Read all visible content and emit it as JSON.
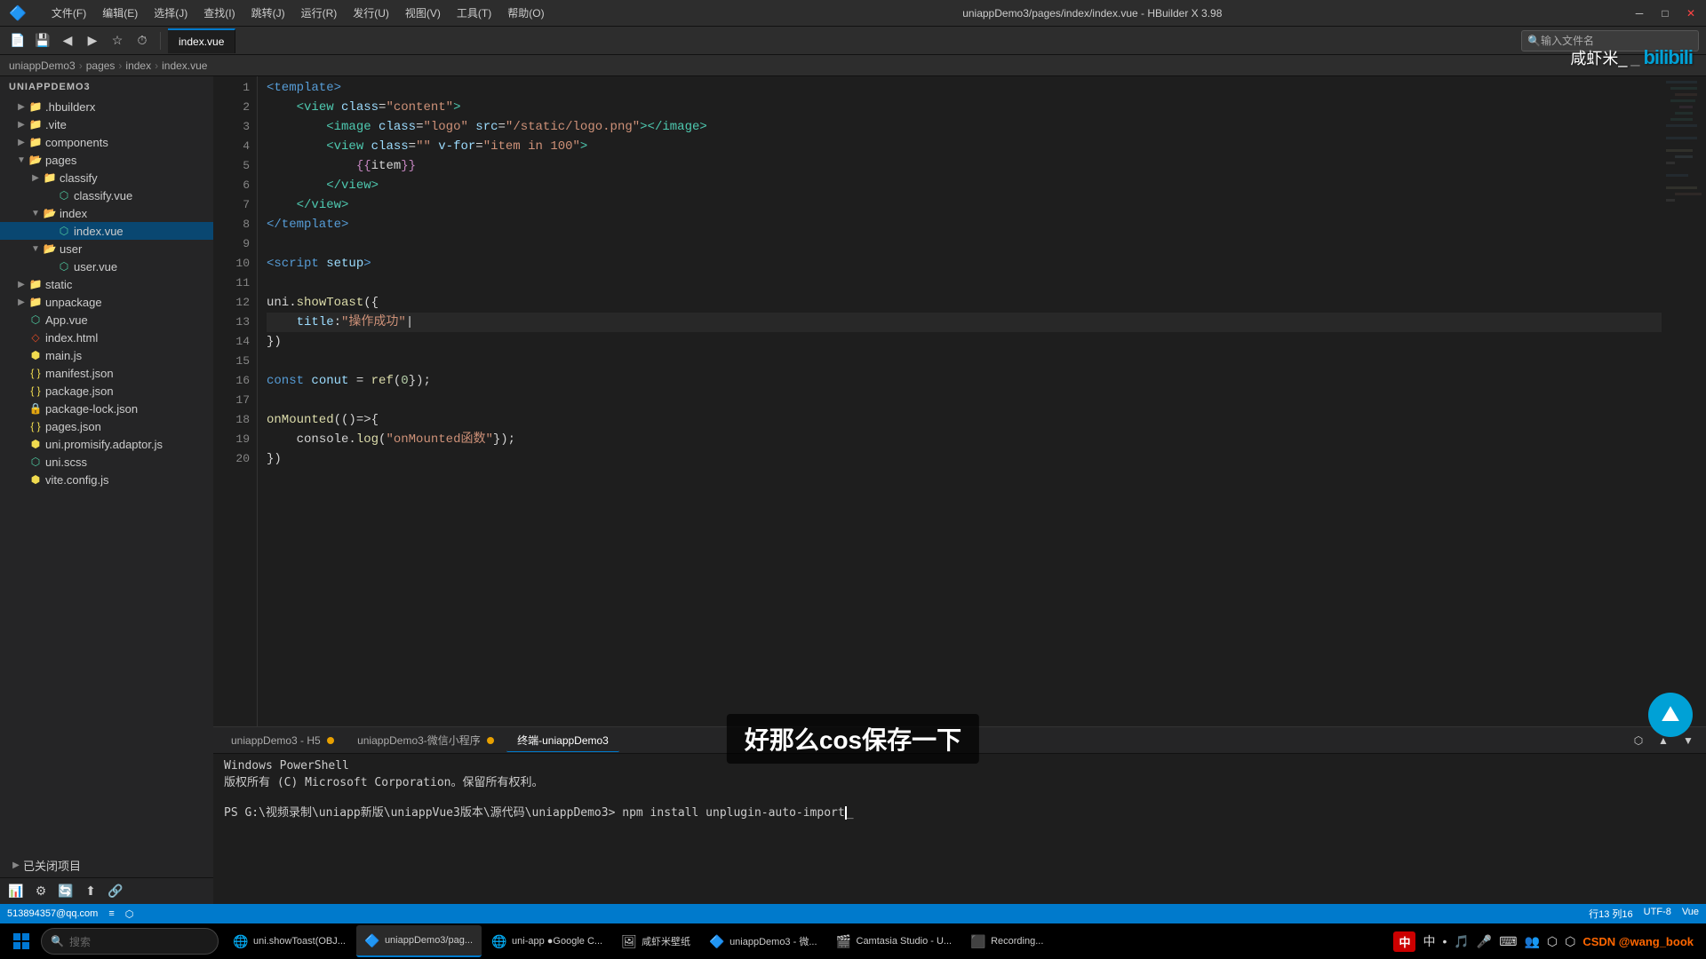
{
  "window": {
    "title": "uniappDemo3/pages/index/index.vue - HBuilder X 3.98",
    "min_btn": "─",
    "max_btn": "□",
    "close_btn": "✕"
  },
  "menu": {
    "items": [
      "文件(F)",
      "编辑(E)",
      "选择(J)",
      "查找(I)",
      "跳转(J)",
      "运行(R)",
      "发行(U)",
      "视图(V)",
      "工具(T)",
      "帮助(O)"
    ]
  },
  "breadcrumb": {
    "items": [
      "uniappDemo3",
      "pages",
      "index",
      "index.vue"
    ]
  },
  "tabs": [
    {
      "label": "index.vue",
      "active": true,
      "dot": false
    },
    {
      "label": "uniappDemo3-微信小程序",
      "active": false,
      "dot": true,
      "dot_color": "orange"
    },
    {
      "label": "终端-uniappDemo3",
      "active": false,
      "dot": false
    }
  ],
  "file_tab": {
    "label": "index.vue"
  },
  "input_filename": {
    "placeholder": "输入文件名"
  },
  "sidebar": {
    "project": "uniappDemo3",
    "items": [
      {
        "id": "hbuilderx",
        "label": ".hbuilderx",
        "type": "folder",
        "depth": 1,
        "collapsed": true
      },
      {
        "id": "vite",
        "label": ".vite",
        "type": "folder",
        "depth": 1,
        "collapsed": true
      },
      {
        "id": "components",
        "label": "components",
        "type": "folder",
        "depth": 1,
        "collapsed": true
      },
      {
        "id": "pages",
        "label": "pages",
        "type": "folder",
        "depth": 1,
        "collapsed": false
      },
      {
        "id": "classify",
        "label": "classify",
        "type": "folder",
        "depth": 2,
        "collapsed": true
      },
      {
        "id": "classify_vue",
        "label": "classify.vue",
        "type": "vue",
        "depth": 3
      },
      {
        "id": "index_folder",
        "label": "index",
        "type": "folder",
        "depth": 2,
        "collapsed": false
      },
      {
        "id": "index_vue",
        "label": "index.vue",
        "type": "vue",
        "depth": 3,
        "selected": true
      },
      {
        "id": "user_folder",
        "label": "user",
        "type": "folder",
        "depth": 2,
        "collapsed": false
      },
      {
        "id": "user_vue",
        "label": "user.vue",
        "type": "vue",
        "depth": 3
      },
      {
        "id": "static",
        "label": "static",
        "type": "folder",
        "depth": 1,
        "collapsed": true
      },
      {
        "id": "unpackage",
        "label": "unpackage",
        "type": "folder",
        "depth": 1,
        "collapsed": true
      },
      {
        "id": "app_vue",
        "label": "App.vue",
        "type": "vue",
        "depth": 1
      },
      {
        "id": "index_html",
        "label": "index.html",
        "type": "html",
        "depth": 1
      },
      {
        "id": "main_js",
        "label": "main.js",
        "type": "js",
        "depth": 1
      },
      {
        "id": "manifest_json",
        "label": "manifest.json",
        "type": "json",
        "depth": 1
      },
      {
        "id": "package_json",
        "label": "package.json",
        "type": "json",
        "depth": 1
      },
      {
        "id": "package_lock",
        "label": "package-lock.json",
        "type": "lock",
        "depth": 1
      },
      {
        "id": "pages_json",
        "label": "pages.json",
        "type": "json",
        "depth": 1
      },
      {
        "id": "uni_promisify",
        "label": "uni.promisify.adaptor.js",
        "type": "js",
        "depth": 1
      },
      {
        "id": "uni_scss",
        "label": "uni.scss",
        "type": "css",
        "depth": 1
      },
      {
        "id": "vite_config",
        "label": "vite.config.js",
        "type": "js",
        "depth": 1
      }
    ],
    "closed_projects": "已关闭项目"
  },
  "code_lines": [
    {
      "num": 1,
      "content": "<template>",
      "tokens": [
        {
          "t": "tmpl",
          "v": "<template>"
        }
      ]
    },
    {
      "num": 2,
      "content": "    <view class=\"content\">",
      "tokens": [
        {
          "t": "plain",
          "v": "    "
        },
        {
          "t": "tag",
          "v": "<view"
        },
        {
          "t": "plain",
          "v": " "
        },
        {
          "t": "attr",
          "v": "class"
        },
        {
          "t": "plain",
          "v": "="
        },
        {
          "t": "str",
          "v": "\"content\""
        },
        {
          "t": "tag",
          "v": ">"
        }
      ]
    },
    {
      "num": 3,
      "content": "        <image class=\"logo\" src=\"/static/logo.png\"></image>",
      "tokens": [
        {
          "t": "plain",
          "v": "        "
        },
        {
          "t": "tag",
          "v": "<image"
        },
        {
          "t": "plain",
          "v": " "
        },
        {
          "t": "attr",
          "v": "class"
        },
        {
          "t": "plain",
          "v": "="
        },
        {
          "t": "str",
          "v": "\"logo\""
        },
        {
          "t": "plain",
          "v": " "
        },
        {
          "t": "attr",
          "v": "src"
        },
        {
          "t": "plain",
          "v": "="
        },
        {
          "t": "str",
          "v": "\"/static/logo.png\""
        },
        {
          "t": "tag",
          "v": "></image>"
        }
      ]
    },
    {
      "num": 4,
      "content": "        <view class=\"\" v-for=\"item in 100\">",
      "tokens": [
        {
          "t": "plain",
          "v": "        "
        },
        {
          "t": "tag",
          "v": "<view"
        },
        {
          "t": "plain",
          "v": " "
        },
        {
          "t": "attr",
          "v": "class"
        },
        {
          "t": "plain",
          "v": "="
        },
        {
          "t": "str",
          "v": "\"\""
        },
        {
          "t": "plain",
          "v": " "
        },
        {
          "t": "attr",
          "v": "v-for"
        },
        {
          "t": "plain",
          "v": "="
        },
        {
          "t": "str",
          "v": "\"item in 100\""
        },
        {
          "t": "tag",
          "v": ">"
        }
      ]
    },
    {
      "num": 5,
      "content": "            {{item}}",
      "tokens": [
        {
          "t": "plain",
          "v": "            "
        },
        {
          "t": "kw2",
          "v": "{{"
        },
        {
          "t": "plain",
          "v": "item"
        },
        {
          "t": "kw2",
          "v": "}}"
        }
      ]
    },
    {
      "num": 6,
      "content": "        </view>",
      "tokens": [
        {
          "t": "plain",
          "v": "        "
        },
        {
          "t": "tag",
          "v": "</view>"
        }
      ]
    },
    {
      "num": 7,
      "content": "    </view>",
      "tokens": [
        {
          "t": "plain",
          "v": "    "
        },
        {
          "t": "tag",
          "v": "</view>"
        }
      ]
    },
    {
      "num": 8,
      "content": "</template>",
      "tokens": [
        {
          "t": "tmpl",
          "v": "</template>"
        }
      ]
    },
    {
      "num": 9,
      "content": "",
      "tokens": []
    },
    {
      "num": 10,
      "content": "<script setup>",
      "tokens": [
        {
          "t": "tmpl",
          "v": "<script"
        },
        {
          "t": "plain",
          "v": " "
        },
        {
          "t": "attr",
          "v": "setup"
        },
        {
          "t": "tmpl",
          "v": ">"
        }
      ]
    },
    {
      "num": 11,
      "content": "",
      "tokens": []
    },
    {
      "num": 12,
      "content": "uni.showToast({",
      "tokens": [
        {
          "t": "plain",
          "v": "uni"
        },
        {
          "t": "punct",
          "v": "."
        },
        {
          "t": "func",
          "v": "showToast"
        },
        {
          "t": "punct",
          "v": "({"
        }
      ]
    },
    {
      "num": 13,
      "content": "    title:\"操作成功\"|",
      "tokens": [
        {
          "t": "plain",
          "v": "    "
        },
        {
          "t": "lightblue",
          "v": "title"
        },
        {
          "t": "punct",
          "v": ":"
        },
        {
          "t": "str",
          "v": "\"操作成功\""
        },
        {
          "t": "plain",
          "v": "|"
        }
      ]
    },
    {
      "num": 14,
      "content": "})",
      "tokens": [
        {
          "t": "punct",
          "v": "})"
        }
      ]
    },
    {
      "num": 15,
      "content": "",
      "tokens": []
    },
    {
      "num": 16,
      "content": "const conut = ref(0);",
      "tokens": [
        {
          "t": "kw",
          "v": "const"
        },
        {
          "t": "plain",
          "v": " "
        },
        {
          "t": "var",
          "v": "conut"
        },
        {
          "t": "plain",
          "v": " = "
        },
        {
          "t": "func",
          "v": "ref"
        },
        {
          "t": "punct",
          "v": "("
        },
        {
          "t": "num",
          "v": "0"
        },
        {
          "t": "punct",
          "v": "});"
        }
      ]
    },
    {
      "num": 17,
      "content": "",
      "tokens": []
    },
    {
      "num": 18,
      "content": "onMounted(()=>{",
      "tokens": [
        {
          "t": "func",
          "v": "onMounted"
        },
        {
          "t": "punct",
          "v": "(()=>{"
        }
      ]
    },
    {
      "num": 19,
      "content": "    console.log(\"onMounted函数\");",
      "tokens": [
        {
          "t": "plain",
          "v": "    "
        },
        {
          "t": "plain",
          "v": "console"
        },
        {
          "t": "punct",
          "v": "."
        },
        {
          "t": "func",
          "v": "log"
        },
        {
          "t": "punct",
          "v": "("
        },
        {
          "t": "str",
          "v": "\"onMounted函数\""
        },
        {
          "t": "punct",
          "v": "});"
        }
      ]
    },
    {
      "num": 20,
      "content": "})",
      "tokens": [
        {
          "t": "punct",
          "v": "})"
        }
      ]
    }
  ],
  "terminal": {
    "tabs": [
      "uniappDemo3 - H5",
      "uniappDemo3-微信小程序",
      "终端-uniappDemo3"
    ],
    "active_tab": 2,
    "content": [
      "Windows PowerShell",
      "版权所有 (C) Microsoft Corporation。保留所有权利。",
      "",
      "PS G:\\视频录制\\uniapp新版\\uniappVue3版本\\源代码\\uniappDemo3> npm install unplugin-auto-import_"
    ]
  },
  "status_bar": {
    "left": [
      "513894357@qq.com"
    ],
    "right": [
      "行13 列16",
      "UTF-8",
      "Vue"
    ]
  },
  "subtitle": "好那么cos保存一下",
  "watermark": {
    "user": "咸虾米_",
    "platform": "bilibili"
  },
  "taskbar": {
    "items": [
      {
        "label": "uni.showToast(OBJ...",
        "icon": "🌐",
        "active": false
      },
      {
        "label": "uniappDemo3/pag...",
        "icon": "🔷",
        "active": true
      },
      {
        "label": "uni-app ●Google C...",
        "icon": "🌐",
        "active": false
      },
      {
        "label": "咸虾米壁纸",
        "icon": "🖼",
        "active": false
      },
      {
        "label": "uniappDemo3 - 微...",
        "icon": "🔷",
        "active": false
      },
      {
        "label": "Camtasia Studio - U...",
        "icon": "🎬",
        "active": false
      },
      {
        "label": "Recording...",
        "icon": "⬛",
        "active": false
      }
    ],
    "sys_tray": {
      "ime": "中",
      "time_area": "CSDN @wang_book"
    }
  },
  "input_method": {
    "label": "中"
  }
}
